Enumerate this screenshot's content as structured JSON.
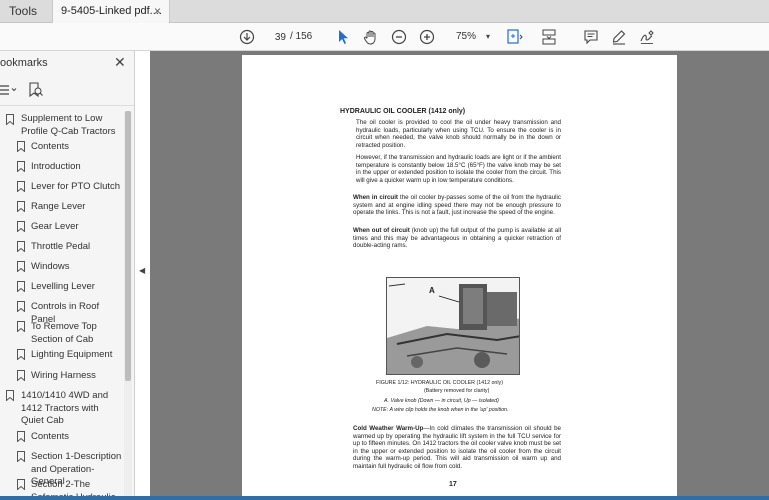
{
  "tabs": {
    "tools_label": "Tools",
    "doc_label": "9-5405-Linked pdf....",
    "close_glyph": "×"
  },
  "toolbar": {
    "current_page": "39",
    "total_pages": "/ 156",
    "zoom": "75%",
    "icons": [
      "download-circle-icon",
      "select-arrow-icon",
      "hand-icon",
      "zoom-out-icon",
      "zoom-in-icon",
      "page-fit-icon",
      "scroll-mode-icon",
      "comment-icon",
      "highlight-pen-icon",
      "sign-icon"
    ],
    "accent_color": "#1f6fd1"
  },
  "sidebar": {
    "title": "ookmarks",
    "close_glyph": "✕",
    "items": [
      {
        "label": "Supplement to Low Profile Q-Cab Tractors",
        "level": 0
      },
      {
        "label": "Contents",
        "level": 1
      },
      {
        "label": "Introduction",
        "level": 1
      },
      {
        "label": "Lever for PTO Clutch",
        "level": 1
      },
      {
        "label": "Range Lever",
        "level": 1
      },
      {
        "label": "Gear Lever",
        "level": 1
      },
      {
        "label": "Throttle Pedal",
        "level": 1
      },
      {
        "label": "Windows",
        "level": 1
      },
      {
        "label": "Levelling Lever",
        "level": 1
      },
      {
        "label": "Controls in Roof Panel",
        "level": 1
      },
      {
        "label": "To Remove Top Section of Cab",
        "level": 1
      },
      {
        "label": "Lighting Equipment",
        "level": 1
      },
      {
        "label": "Wiring Harness",
        "level": 1
      },
      {
        "label": "1410/1410 4WD and 1412 Tractors with Quiet Cab",
        "level": 0
      },
      {
        "label": "Contents",
        "level": 1
      },
      {
        "label": "Section 1-Description and Operation-General",
        "level": 1
      },
      {
        "label": "Section 2-The Safematic Hydraulic",
        "level": 1
      }
    ]
  },
  "document": {
    "heading": "HYDRAULIC OIL COOLER (1412 only)",
    "para1": "The oil cooler is provided to cool the oil under heavy transmission and hydraulic loads, particularly when using TCU. To ensure the cooler is in circuit when needed, the valve knob should normally be in the down or retracted position.",
    "para2": "However, if the transmission and hydraulic loads are light or if the ambient temperature is constantly below 18.5°C (65°F) the valve knob may be set in the upper or extended position to isolate the cooler from the circuit. This will give a quicker warm up in low temperature conditions.",
    "para3_lead": "When in circuit",
    "para3": " the oil cooler by-passes some of the oil from the hydraulic system and at engine idling speed there may not be enough pressure to operate the links. This is not a fault, just increase the speed of the engine.",
    "para4_lead": "When out of circuit",
    "para4": " (knob up) the full output of the pump is available at all times and this may be advantageous in obtaining a quicker retraction of double-acting rams.",
    "figure_label": "A",
    "caption1": "FIGURE 1/12: HYDRAULIC OIL COOLER (1412 only)",
    "caption2": "(Battery removed for clarity)",
    "caption3": "A.  Valve knob (Down — in circuit, Up — isolated)",
    "caption4": "NOTE: A wire clip holds the knob when in the 'up' position.",
    "para5_lead": "Cold Weather Warm-Up",
    "para5": "—In cold climates the transmission oil should be warmed up by operating the hydraulic lift system in the full TCU service for up to fifteen minutes. On 1412 tractors the oil cooler valve knob must be set in the upper or extended position to isolate the oil cooler from the circuit during the warm-up period. This will aid transmission oil warm up and maintain full hydraulic oil flow from cold.",
    "page_number": "17"
  }
}
